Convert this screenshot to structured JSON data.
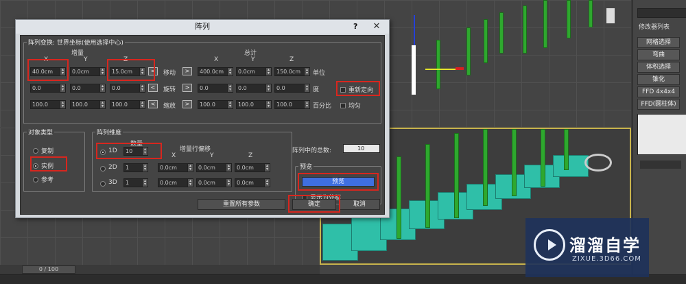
{
  "dialog": {
    "title": "阵列",
    "help": "?",
    "close": "✕"
  },
  "transform": {
    "group_title": "阵列变换: 世界坐标(使用选择中心)",
    "increment_label": "增量",
    "total_label": "总计",
    "axes": [
      "X",
      "Y",
      "Z"
    ],
    "rows": [
      {
        "label": "移动",
        "unit": "单位",
        "inc": [
          "40.0cm",
          "0.0cm",
          "15.0cm"
        ],
        "tot": [
          "400.0cm",
          "0.0cm",
          "150.0cm"
        ]
      },
      {
        "label": "旋转",
        "unit": "度",
        "inc": [
          "0.0",
          "0.0",
          "0.0"
        ],
        "tot": [
          "0.0",
          "0.0",
          "0.0"
        ]
      },
      {
        "label": "缩放",
        "unit": "百分比",
        "inc": [
          "100.0",
          "100.0",
          "100.0"
        ],
        "tot": [
          "100.0",
          "100.0",
          "100.0"
        ]
      }
    ],
    "arrow_left": "<",
    "arrow_right": ">",
    "reorient": "重新定向",
    "uniform": "均匀"
  },
  "object_type": {
    "group_title": "对象类型",
    "options": [
      "复制",
      "实例",
      "参考"
    ],
    "selected": "实例"
  },
  "dimensions": {
    "group_title": "阵列维度",
    "count_label": "数量",
    "offset_label": "增量行偏移",
    "axes": [
      "X",
      "Y",
      "Z"
    ],
    "rows": [
      {
        "label": "1D",
        "count": "10"
      },
      {
        "label": "2D",
        "count": "1",
        "offsets": [
          "0.0cm",
          "0.0cm",
          "0.0cm"
        ]
      },
      {
        "label": "3D",
        "count": "1",
        "offsets": [
          "0.0cm",
          "0.0cm",
          "0.0cm"
        ]
      }
    ]
  },
  "total": {
    "label": "阵列中的总数:",
    "value": "10"
  },
  "preview": {
    "group_title": "预览",
    "button": "预览",
    "as_box": "显示为外框"
  },
  "buttons": {
    "reset": "重置所有参数",
    "ok": "确定",
    "cancel": "取消"
  },
  "right_panel": {
    "modifier_list": "修改器列表",
    "items": [
      "网格选择",
      "弯曲",
      "体积选择",
      "锥化",
      "FFD 4x4x4",
      "FFD(圆柱体)"
    ]
  },
  "timeline": {
    "frame": "0 / 100"
  },
  "watermark": {
    "title": "溜溜自学",
    "url": "ZIXUE.3D66.COM"
  },
  "colors": {
    "highlight": "#d8261e",
    "preview_button": "#3f6fe0",
    "stairs": "#2fbfa8",
    "pillars": "#2ea82e"
  }
}
